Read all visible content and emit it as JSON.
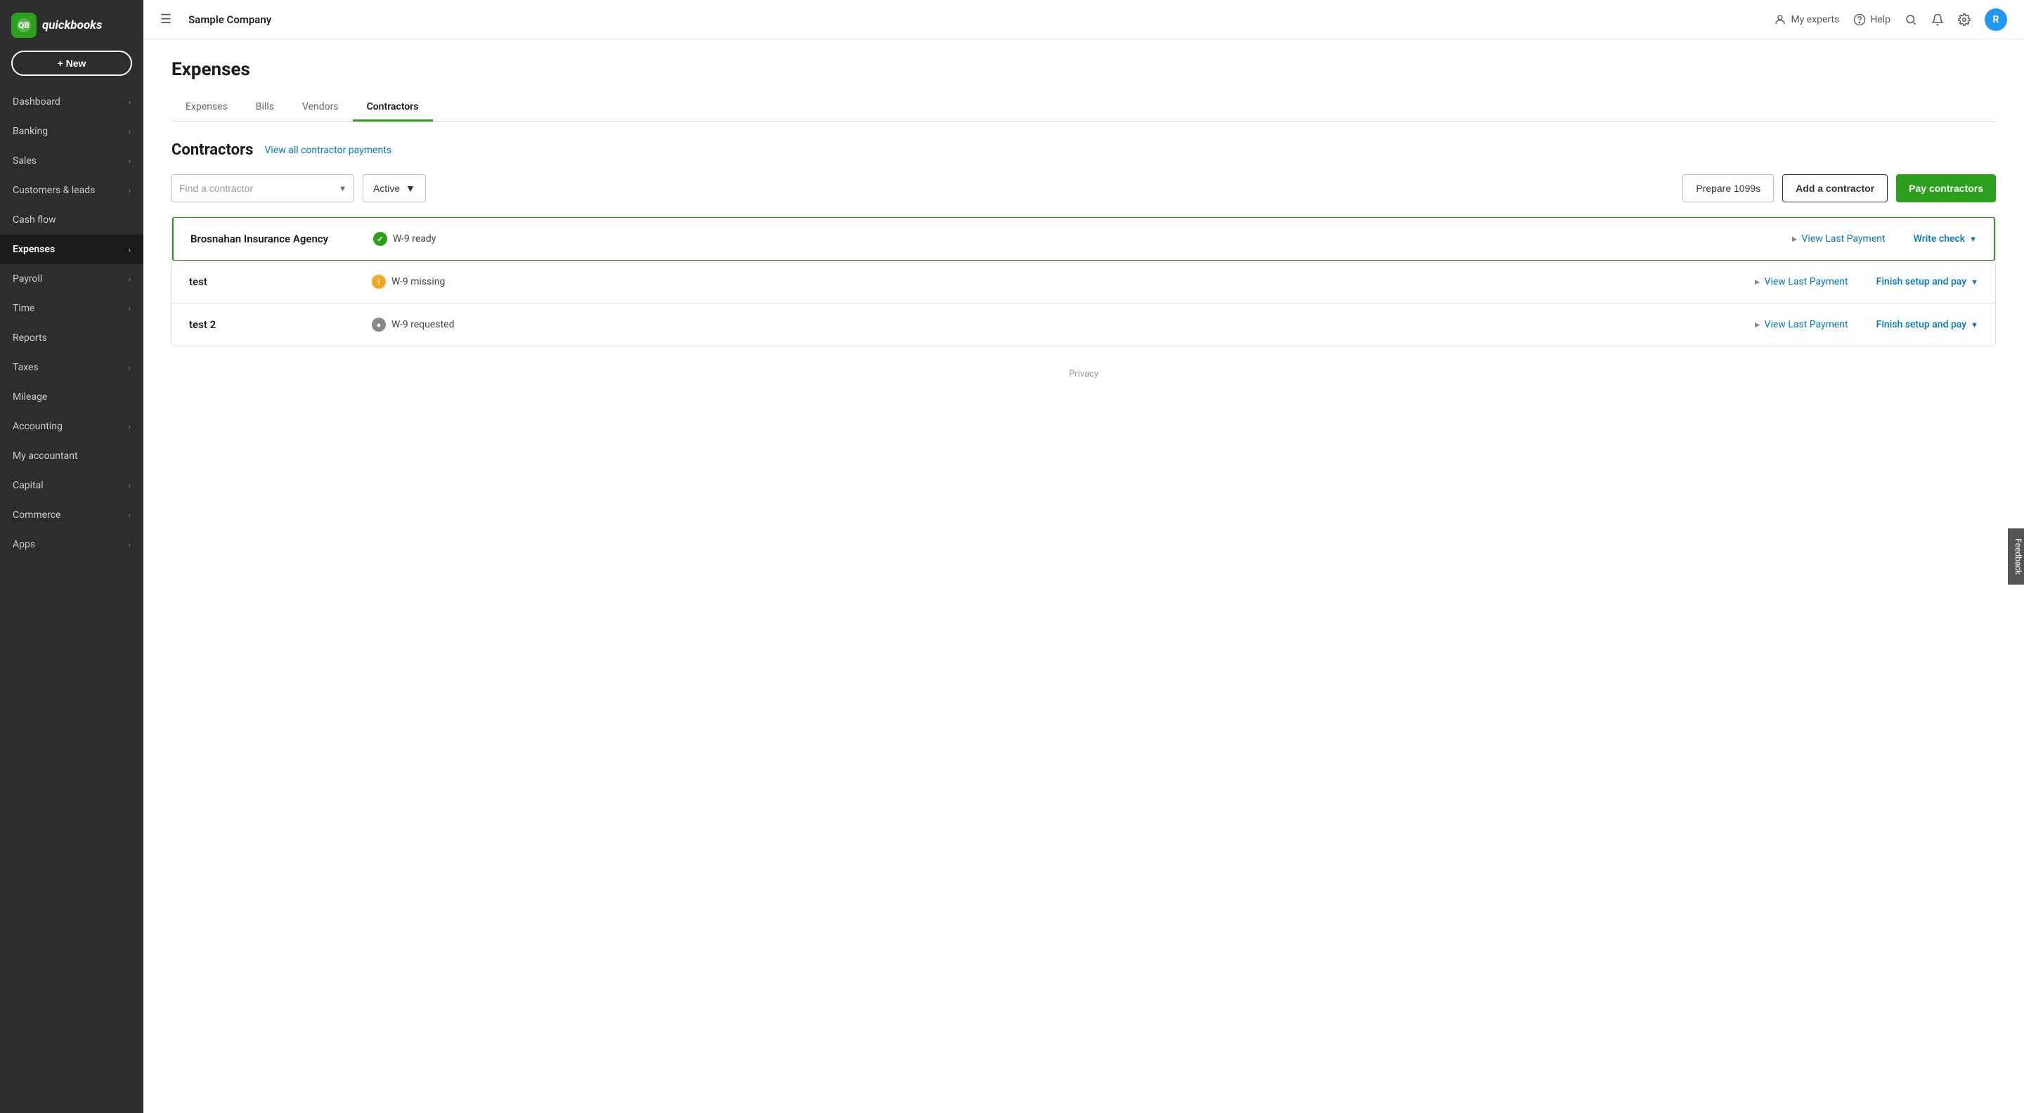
{
  "sidebar": {
    "logo_text": "quickbooks",
    "new_button": "+ New",
    "items": [
      {
        "label": "Dashboard",
        "has_arrow": true,
        "active": false
      },
      {
        "label": "Banking",
        "has_arrow": true,
        "active": false
      },
      {
        "label": "Sales",
        "has_arrow": true,
        "active": false
      },
      {
        "label": "Customers & leads",
        "has_arrow": true,
        "active": false
      },
      {
        "label": "Cash flow",
        "has_arrow": false,
        "active": false
      },
      {
        "label": "Expenses",
        "has_arrow": true,
        "active": true
      },
      {
        "label": "Payroll",
        "has_arrow": true,
        "active": false
      },
      {
        "label": "Time",
        "has_arrow": true,
        "active": false
      },
      {
        "label": "Reports",
        "has_arrow": false,
        "active": false
      },
      {
        "label": "Taxes",
        "has_arrow": true,
        "active": false
      },
      {
        "label": "Mileage",
        "has_arrow": false,
        "active": false
      },
      {
        "label": "Accounting",
        "has_arrow": true,
        "active": false
      },
      {
        "label": "My accountant",
        "has_arrow": false,
        "active": false
      },
      {
        "label": "Capital",
        "has_arrow": true,
        "active": false
      },
      {
        "label": "Commerce",
        "has_arrow": true,
        "active": false
      },
      {
        "label": "Apps",
        "has_arrow": true,
        "active": false
      }
    ]
  },
  "topbar": {
    "company": "Sample Company",
    "my_experts": "My experts",
    "help": "Help",
    "avatar_letter": "R"
  },
  "page": {
    "title": "Expenses",
    "tabs": [
      {
        "label": "Expenses",
        "active": false
      },
      {
        "label": "Bills",
        "active": false
      },
      {
        "label": "Vendors",
        "active": false
      },
      {
        "label": "Contractors",
        "active": true
      }
    ]
  },
  "contractors": {
    "section_title": "Contractors",
    "view_all_link": "View all contractor payments",
    "search_placeholder": "Find a contractor",
    "filter_label": "Active",
    "prepare_1099s": "Prepare 1099s",
    "add_contractor": "Add a contractor",
    "pay_contractors": "Pay contractors",
    "rows": [
      {
        "name": "Brosnahan Insurance Agency",
        "w9_icon": "green",
        "w9_label": "W-9 ready",
        "action": "Write check",
        "highlighted": true
      },
      {
        "name": "test",
        "w9_icon": "yellow",
        "w9_label": "W-9 missing",
        "action": "Finish setup and pay",
        "highlighted": false
      },
      {
        "name": "test 2",
        "w9_icon": "gray",
        "w9_label": "W-9 requested",
        "action": "Finish setup and pay",
        "highlighted": false
      }
    ],
    "view_last_payment": "View Last Payment",
    "privacy": "Privacy"
  },
  "feedback": "Feedback"
}
